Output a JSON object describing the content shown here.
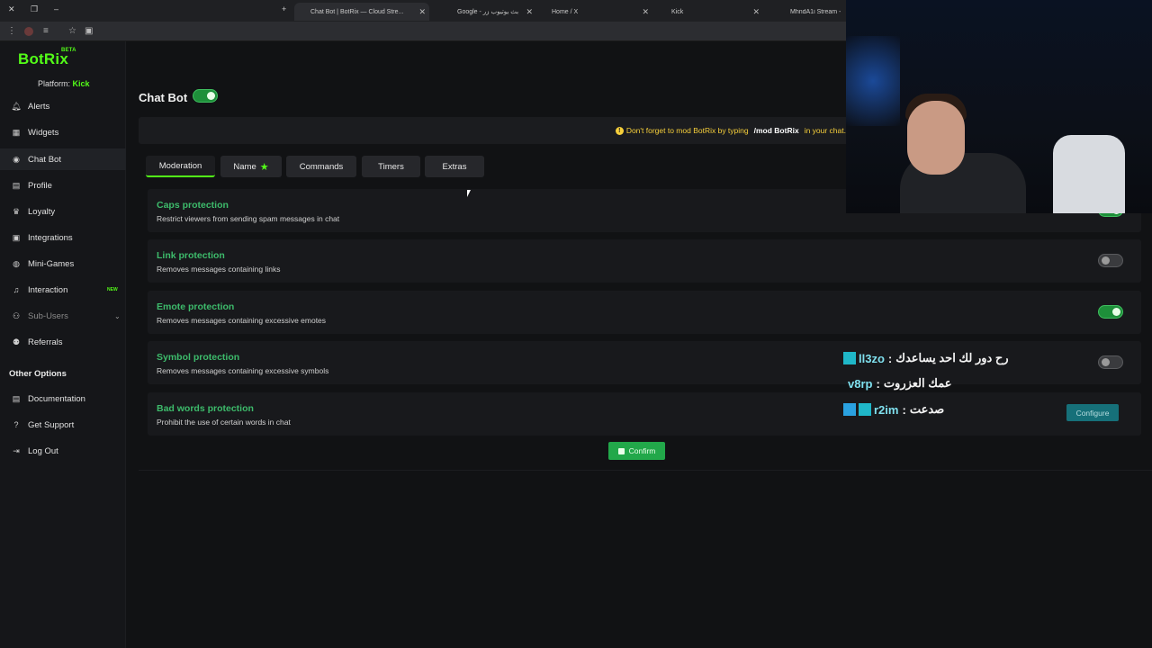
{
  "browser": {
    "tabs": [
      {
        "label": "Chat Bot | BotRix — Cloud Stre...",
        "active": true
      },
      {
        "label": "Google - بث يوتيوب زر",
        "active": false
      },
      {
        "label": "Home / X",
        "active": false
      },
      {
        "label": "Kick",
        "active": false
      },
      {
        "label": "MhndA1i Stream - W...",
        "active": false
      }
    ],
    "new_tab": "+"
  },
  "sidebar": {
    "logo": "BotRix",
    "logo_tag": "BETA",
    "platform_label": "Platform:",
    "platform_value": "Kick",
    "items": [
      {
        "label": "Alerts",
        "icon": "bell-icon"
      },
      {
        "label": "Widgets",
        "icon": "grid-icon"
      },
      {
        "label": "Chat Bot",
        "icon": "robot-icon"
      },
      {
        "label": "Profile",
        "icon": "profile-icon"
      },
      {
        "label": "Loyalty",
        "icon": "trophy-icon"
      },
      {
        "label": "Integrations",
        "icon": "integrations-icon"
      },
      {
        "label": "Mini-Games",
        "icon": "gamepad-icon"
      },
      {
        "label": "Interaction",
        "icon": "music-icon",
        "badge": "NEW"
      },
      {
        "label": "Sub-Users",
        "icon": "users-icon"
      },
      {
        "label": "Referrals",
        "icon": "referral-icon"
      }
    ],
    "other_options_title": "Other Options",
    "other_items": [
      {
        "label": "Documentation",
        "icon": "doc-icon"
      },
      {
        "label": "Get Support",
        "icon": "help-icon"
      },
      {
        "label": "Log Out",
        "icon": "logout-icon"
      }
    ]
  },
  "main": {
    "title": "Chat Bot",
    "notice_prefix": "Don't forget to mod BotRix by typing",
    "notice_command": "/mod BotRix",
    "notice_suffix": "in your chat.",
    "tabs": [
      "Moderation",
      "Name",
      "Commands",
      "Timers",
      "Extras"
    ],
    "protections": [
      {
        "title": "Caps protection",
        "desc": "Restrict viewers from sending spam messages in chat",
        "enabled": true
      },
      {
        "title": "Link protection",
        "desc": "Removes messages containing links",
        "enabled": false
      },
      {
        "title": "Emote protection",
        "desc": "Removes messages containing excessive emotes",
        "enabled": true
      },
      {
        "title": "Symbol protection",
        "desc": "Removes messages containing excessive symbols",
        "enabled": false
      },
      {
        "title": "Bad words protection",
        "desc": "Prohibit the use of certain words in chat",
        "enabled": null
      }
    ],
    "configure_label": "Configure",
    "confirm_label": "Confirm"
  },
  "chat_overlay": [
    {
      "user": "ll3zo",
      "message": "رح دور لك احد يساعدك"
    },
    {
      "user": "v8rp",
      "message": "عمك العزروت"
    },
    {
      "user": "r2im",
      "message": "صدعت"
    }
  ],
  "colors": {
    "accent": "#53fc18",
    "title_green": "#3dbb6b",
    "notice_yellow": "#f6cf3b",
    "configure": "#167079"
  }
}
